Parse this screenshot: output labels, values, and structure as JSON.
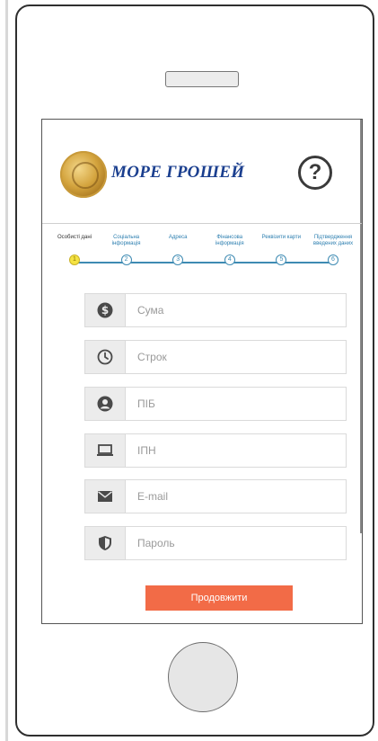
{
  "brand": {
    "name": "МОРЕ ГРОШЕЙ",
    "help_icon": "question-mark-icon"
  },
  "steps": [
    {
      "label": "Особисті дані",
      "number": "1",
      "active": true
    },
    {
      "label": "Соціальна інформація",
      "number": "2",
      "active": false
    },
    {
      "label": "Адреса",
      "number": "3",
      "active": false
    },
    {
      "label": "Фінансова інформація",
      "number": "4",
      "active": false
    },
    {
      "label": "Реквізити карти",
      "number": "5",
      "active": false
    },
    {
      "label": "Підтвердження введених даних",
      "number": "6",
      "active": false
    }
  ],
  "fields": [
    {
      "icon": "dollar-icon",
      "placeholder": "Сума"
    },
    {
      "icon": "clock-icon",
      "placeholder": "Строк"
    },
    {
      "icon": "user-icon",
      "placeholder": "ПІБ"
    },
    {
      "icon": "laptop-icon",
      "placeholder": "ІПН"
    },
    {
      "icon": "envelope-icon",
      "placeholder": "E-mail"
    },
    {
      "icon": "shield-icon",
      "placeholder": "Пароль"
    }
  ],
  "submit_label": "Продовжити",
  "colors": {
    "accent": "#f26b47",
    "step_line": "#3e8bb3",
    "active_step": "#f5e342",
    "brand": "#1b3f8f"
  }
}
